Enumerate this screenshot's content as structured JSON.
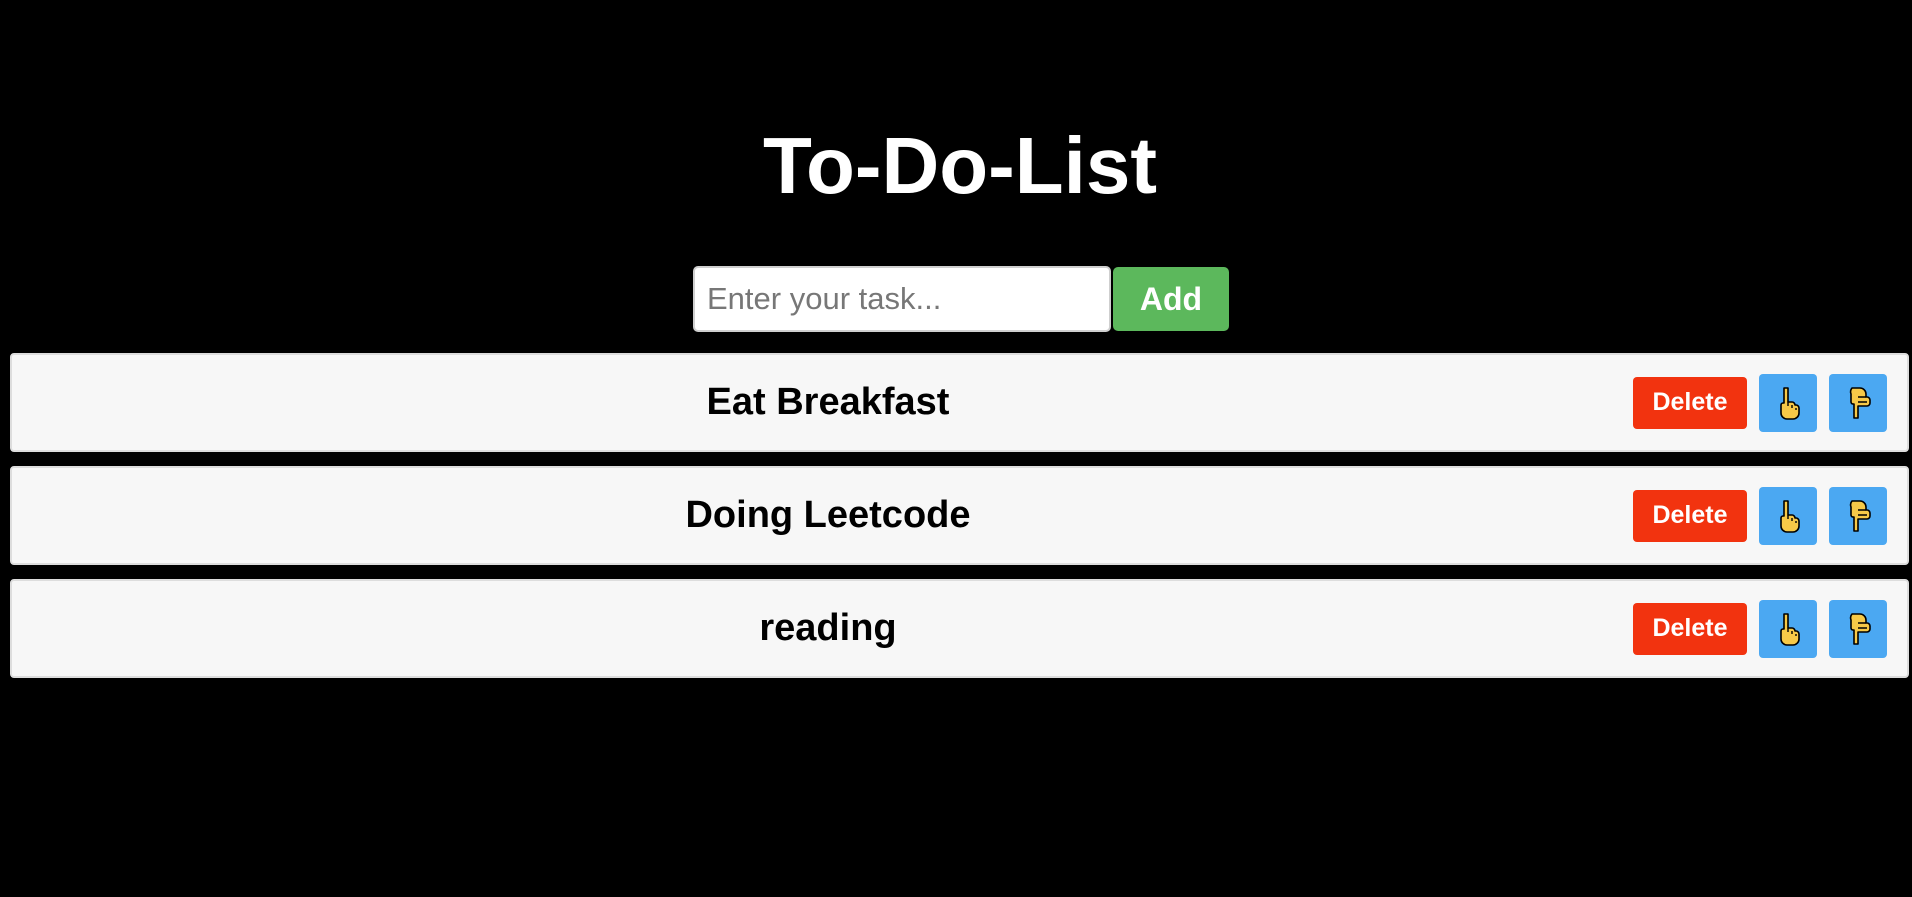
{
  "header": {
    "title": "To-Do-List"
  },
  "input": {
    "placeholder": "Enter your task...",
    "value": "",
    "add_label": "Add"
  },
  "tasks": [
    {
      "text": "Eat Breakfast",
      "delete_label": "Delete",
      "up_icon": "pointing-up-hand-icon",
      "down_icon": "pointing-down-hand-icon"
    },
    {
      "text": "Doing Leetcode",
      "delete_label": "Delete",
      "up_icon": "pointing-up-hand-icon",
      "down_icon": "pointing-down-hand-icon"
    },
    {
      "text": "reading",
      "delete_label": "Delete",
      "up_icon": "pointing-up-hand-icon",
      "down_icon": "pointing-down-hand-icon"
    }
  ],
  "colors": {
    "background": "#000000",
    "add_button": "#5cb85c",
    "delete_button": "#f2330f",
    "move_button": "#4ba8f2",
    "task_background": "#f7f7f7",
    "hand_fill": "#f7c948"
  }
}
